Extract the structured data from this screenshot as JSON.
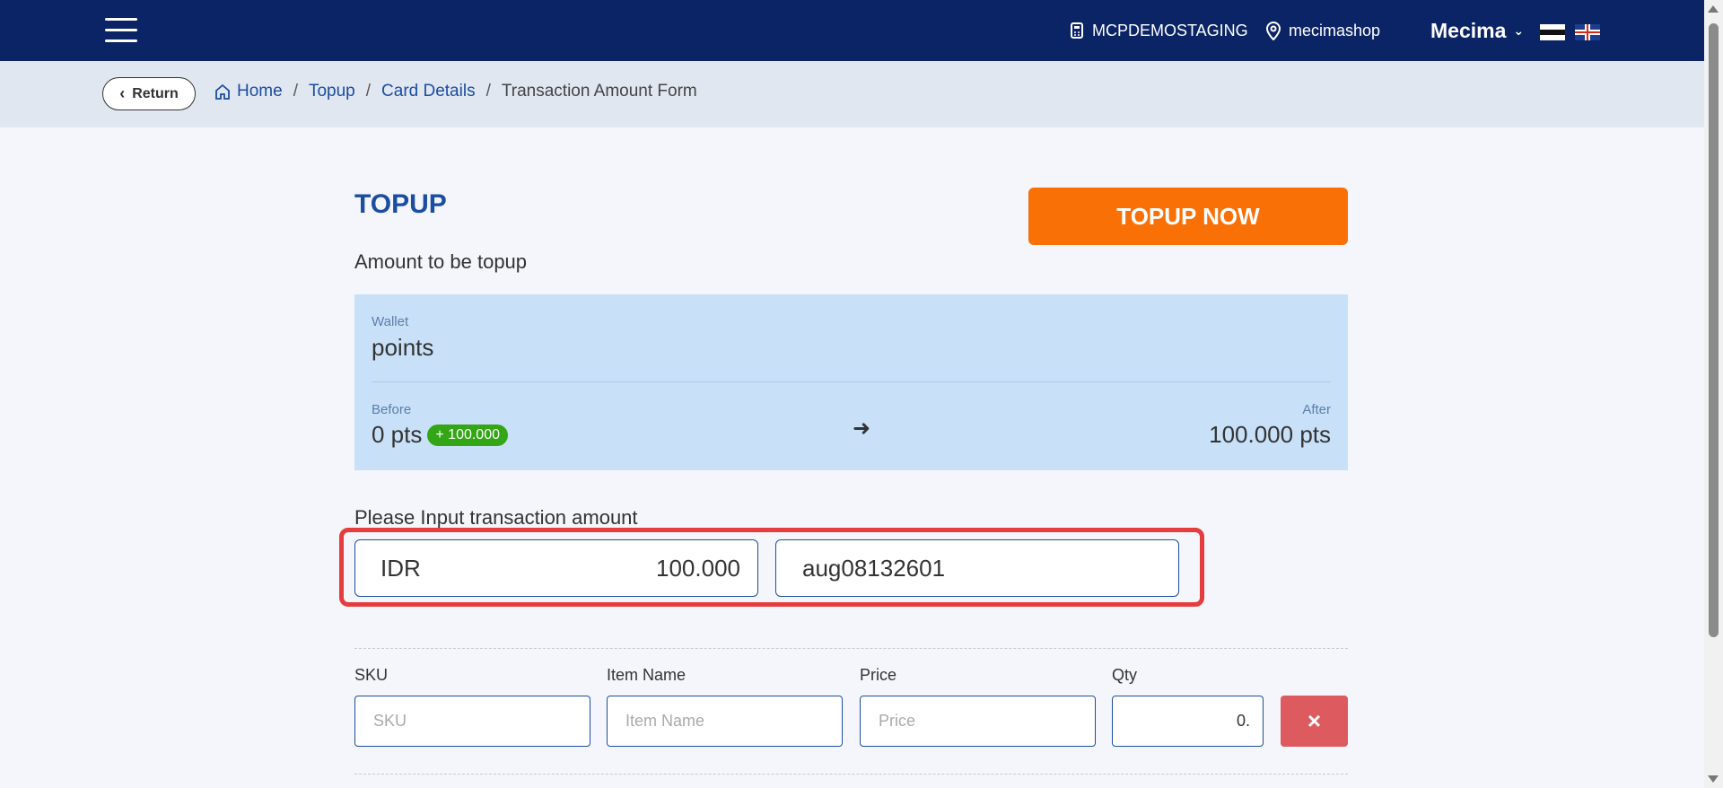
{
  "header": {
    "store_name": "MCPDEMOSTAGING",
    "shop_name": "mecimashop",
    "user_name": "Mecima",
    "menu_icon": "hamburger-icon",
    "languages": [
      "Estonian",
      "English"
    ]
  },
  "breadcrumb": {
    "return_label": "Return",
    "items": [
      "Home",
      "Topup",
      "Card Details",
      "Transaction Amount Form"
    ]
  },
  "page": {
    "title": "TOPUP",
    "subtitle": "Amount to be topup",
    "action_label": "TOPUP NOW"
  },
  "wallet": {
    "label": "Wallet",
    "value": "points",
    "before_label": "Before",
    "before_value": "0 pts",
    "delta": "+ 100.000",
    "after_label": "After",
    "after_value": "100.000 pts"
  },
  "transaction": {
    "label": "Please Input transaction amount",
    "currency": "IDR",
    "amount": "100.000",
    "reference": "aug08132601"
  },
  "item_form": {
    "sku_label": "SKU",
    "sku_placeholder": "SKU",
    "item_label": "Item Name",
    "item_placeholder": "Item Name",
    "price_label": "Price",
    "price_placeholder": "Price",
    "qty_label": "Qty",
    "qty_value": "0.",
    "remove_symbol": "×"
  },
  "colors": {
    "navy": "#0b2466",
    "accent": "#f97007",
    "link": "#1b4da0",
    "wallet_bg": "#c9e1f8",
    "success": "#32a615",
    "danger": "#dd5a5f",
    "highlight": "#e53d3d"
  }
}
